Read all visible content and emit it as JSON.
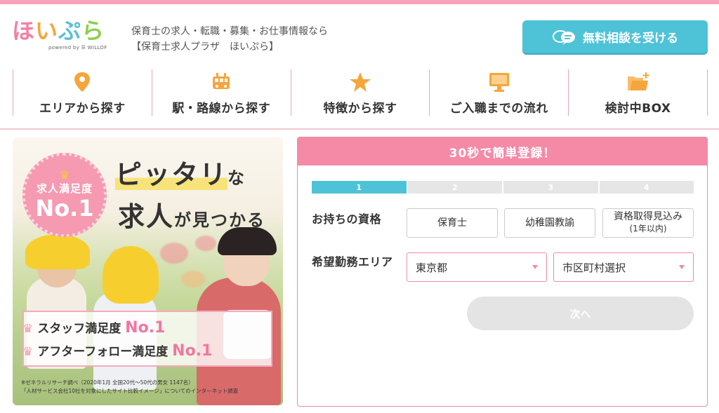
{
  "brand": {
    "logo_text": [
      "ほ",
      "い",
      "ぷ",
      "ら"
    ],
    "powered_by": "powered by ☰ WILLOF"
  },
  "header": {
    "tagline_line1": "保育士の求人・転職・募集・お仕事情報なら",
    "tagline_line2": "【保育士求人プラザ　ほいぷら】",
    "cta_label": "無料相談を受ける"
  },
  "nav": {
    "items": [
      {
        "label": "エリアから探す",
        "icon": "map-pin-icon"
      },
      {
        "label": "駅・路線から探す",
        "icon": "train-icon"
      },
      {
        "label": "特徴から探す",
        "icon": "star-icon"
      },
      {
        "label": "ご入職までの流れ",
        "icon": "monitor-icon"
      },
      {
        "label": "検討中BOX",
        "icon": "folder-plus-icon"
      }
    ]
  },
  "banner": {
    "badge_line1": "求人満足度",
    "badge_line2": "No.1",
    "headline1_main": "ピッタリ",
    "headline1_small": "な",
    "headline2_main": "求人",
    "headline2_small": "が見つかる",
    "award1_label": "スタッフ満足度",
    "award1_no": "No.1",
    "award2_label": "アフターフォロー満足度",
    "award2_no": "No.1",
    "note_line1": "※ゼネラルリサーチ調べ（2020年1月 全国20代〜50代の男女 1147名）",
    "note_line2": "「人材サービス会社10社を対象にしたサイト比較イメージ」についてのインターネット調査"
  },
  "form": {
    "title": "30秒で簡単登録！",
    "steps": [
      "1",
      "2",
      "3",
      "4"
    ],
    "active_step": 1,
    "qual_label": "お持ちの資格",
    "qual_options": [
      {
        "label": "保育士",
        "sub": ""
      },
      {
        "label": "幼稚園教諭",
        "sub": ""
      },
      {
        "label": "資格取得見込み",
        "sub": "(1年以内)"
      }
    ],
    "area_label": "希望勤務エリア",
    "prefecture_value": "東京都",
    "city_value": "市区町村選択",
    "next_label": "次へ"
  },
  "colors": {
    "pink": "#f58aa6",
    "cyan": "#4ec3d8",
    "icon_orange": "#f6a53b"
  }
}
